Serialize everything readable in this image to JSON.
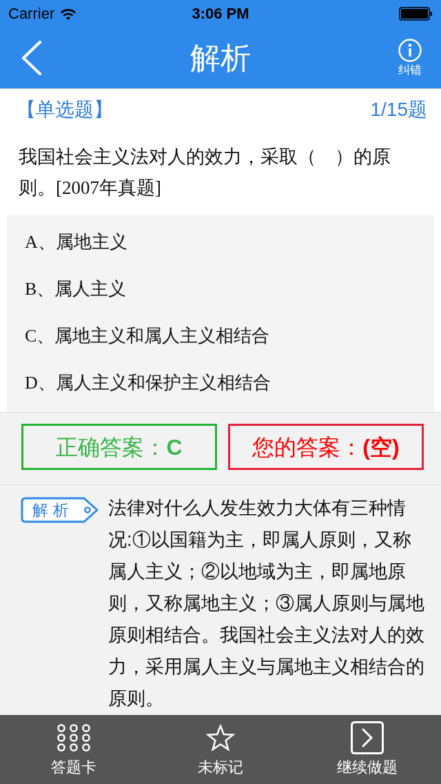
{
  "status_bar": {
    "carrier": "Carrier",
    "time": "3:06 PM"
  },
  "nav_bar": {
    "title": "解析",
    "right_button": {
      "label": "纠错"
    }
  },
  "question": {
    "type": "【单选题】",
    "progress": "1/15题",
    "text": "我国社会主义法对人的效力，采取（　）的原则。[2007年真题]",
    "options": [
      {
        "label": "A、属地主义",
        "selected": false
      },
      {
        "label": "B、属人主义",
        "selected": false
      },
      {
        "label": "C、属地主义和属人主义相结合",
        "selected": false
      },
      {
        "label": "D、属人主义和保护主义相结合",
        "selected": false
      }
    ]
  },
  "answers": [
    {
      "kind": "correct",
      "text": "正确答案：**C**"
    },
    {
      "kind": "yours",
      "text": "您的答案：**(空)**"
    }
  ],
  "explanation": {
    "tag": "解析",
    "text": "法律对什么人发生效力大体有三种情况:①以国籍为主，即属人原则，又称属人主义；②以地域为主，即属地原则，又称属地主义；③属人原则与属地原则相结合。我国社会主义法对人的效力，采用属人主义与属地主义相结合的原则。"
  },
  "toolbar": [
    {
      "kind": "grid",
      "label": "答题卡"
    },
    {
      "kind": "star",
      "label": "未标记"
    },
    {
      "kind": "next",
      "label": "继续做题"
    }
  ]
}
